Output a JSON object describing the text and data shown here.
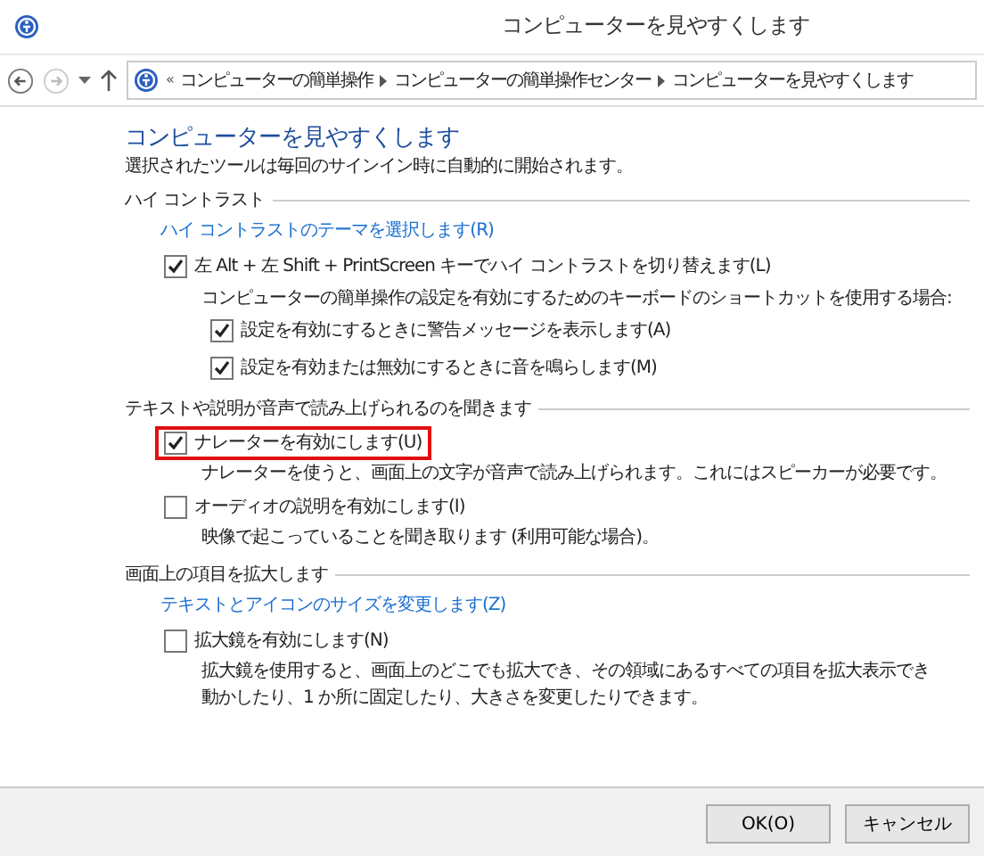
{
  "window": {
    "title": "コンピューターを見やすくします"
  },
  "breadcrumb": {
    "overflow": "«",
    "items": [
      "コンピューターの簡単操作",
      "コンピューターの簡単操作センター",
      "コンピューターを見やすくします"
    ]
  },
  "heading": "コンピューターを見やすくします",
  "subtitle": "選択されたツールは毎回のサインイン時に自動的に開始されます。",
  "sections": [
    {
      "title": "ハイ コントラスト",
      "items": [
        {
          "kind": "link",
          "text": "ハイ コントラストのテーマを選択します(R)"
        },
        {
          "kind": "checkbox",
          "text": "左 Alt + 左 Shift + PrintScreen キーでハイ コントラストを切り替えます(L)",
          "checked": true,
          "highlighted": false
        },
        {
          "kind": "note",
          "text": "コンピューターの簡単操作の設定を有効にするためのキーボードのショートカットを使用する場合:"
        },
        {
          "kind": "subcheckbox",
          "text": "設定を有効にするときに警告メッセージを表示します(A)",
          "checked": true
        },
        {
          "kind": "subcheckbox",
          "text": "設定を有効または無効にするときに音を鳴らします(M)",
          "checked": true
        }
      ]
    },
    {
      "title": "テキストや説明が音声で読み上げられるのを聞きます",
      "items": [
        {
          "kind": "checkbox",
          "text": "ナレーターを有効にします(U)",
          "checked": true,
          "highlighted": true
        },
        {
          "kind": "desc",
          "text": "ナレーターを使うと、画面上の文字が音声で読み上げられます。これにはスピーカーが必要です。"
        },
        {
          "kind": "checkbox",
          "text": "オーディオの説明を有効にします(I)",
          "checked": false,
          "highlighted": false
        },
        {
          "kind": "desc",
          "text": "映像で起こっていることを聞き取ります (利用可能な場合)。"
        }
      ]
    },
    {
      "title": "画面上の項目を拡大します",
      "items": [
        {
          "kind": "link",
          "text": "テキストとアイコンのサイズを変更します(Z)"
        },
        {
          "kind": "checkbox",
          "text": "拡大鏡を有効にします(N)",
          "checked": false,
          "highlighted": false
        },
        {
          "kind": "desc",
          "text": "拡大鏡を使用すると、画面上のどこでも拡大でき、その領域にあるすべての項目を拡大表示でき"
        },
        {
          "kind": "desc",
          "text": "動かしたり、1 か所に固定したり、大きさを変更したりできます。"
        }
      ]
    }
  ],
  "buttons": [
    "OK(O)",
    "キャンセル"
  ]
}
